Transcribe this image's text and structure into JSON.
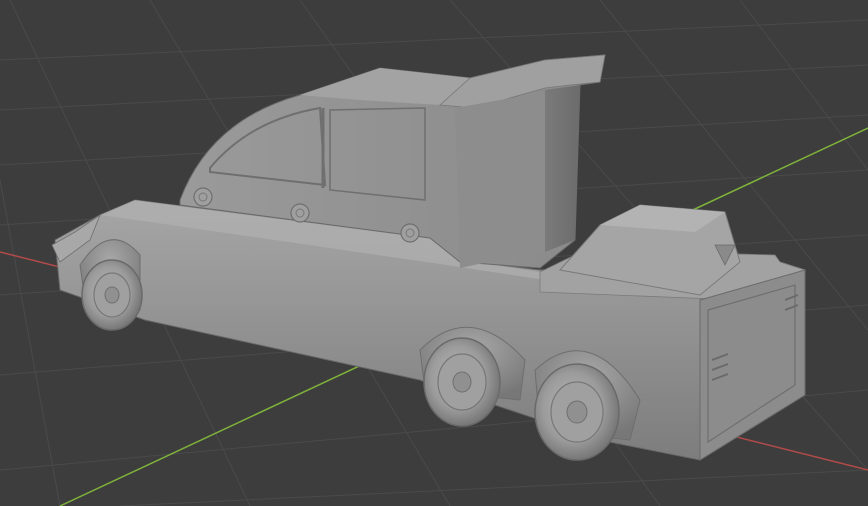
{
  "viewport": {
    "type": "3d-viewport",
    "background_color": "#3d3d3d",
    "grid_color": "#4a4a4a",
    "x_axis_color": "#b34a4a",
    "y_axis_color": "#7fb33a",
    "object": {
      "kind": "truck-model",
      "shading": "solid",
      "base_color": "#8f8f8f",
      "wheels_visible": 3
    }
  }
}
